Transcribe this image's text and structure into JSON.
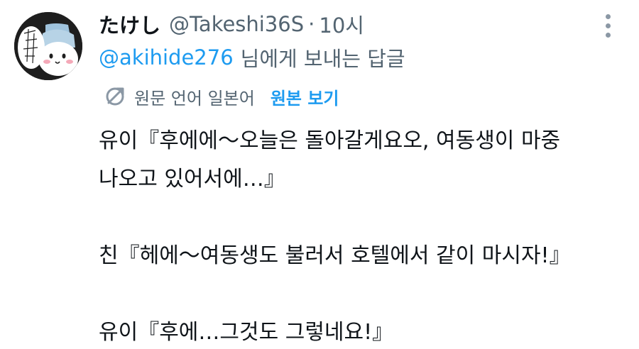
{
  "tweet": {
    "author": {
      "display_name": "たけし",
      "handle": "@Takeshi36S",
      "avatar_icon": "character-avatar-icon"
    },
    "separator": "·",
    "time": "10시",
    "more_icon": "more-vertical-icon",
    "reply": {
      "mention": "@akihide276",
      "suffix": "님에게 보내는 답글"
    },
    "translation": {
      "icon": "translate-icon",
      "note": "원문 언어 일본어",
      "show_original": "원본 보기"
    },
    "body_lines": [
      "유이『후에에〜오늘은 돌아갈게요오, 여동생이 마중",
      "나오고 있어서에…』",
      "친『헤에〜여동생도 불러서 호텔에서 같이 마시자!』",
      "유이『후에…그것도 그렇네요!』"
    ]
  },
  "colors": {
    "text_primary": "#0f1419",
    "text_secondary": "#536471",
    "accent": "#1d9bf0",
    "icon_gray": "#8b98a5"
  }
}
